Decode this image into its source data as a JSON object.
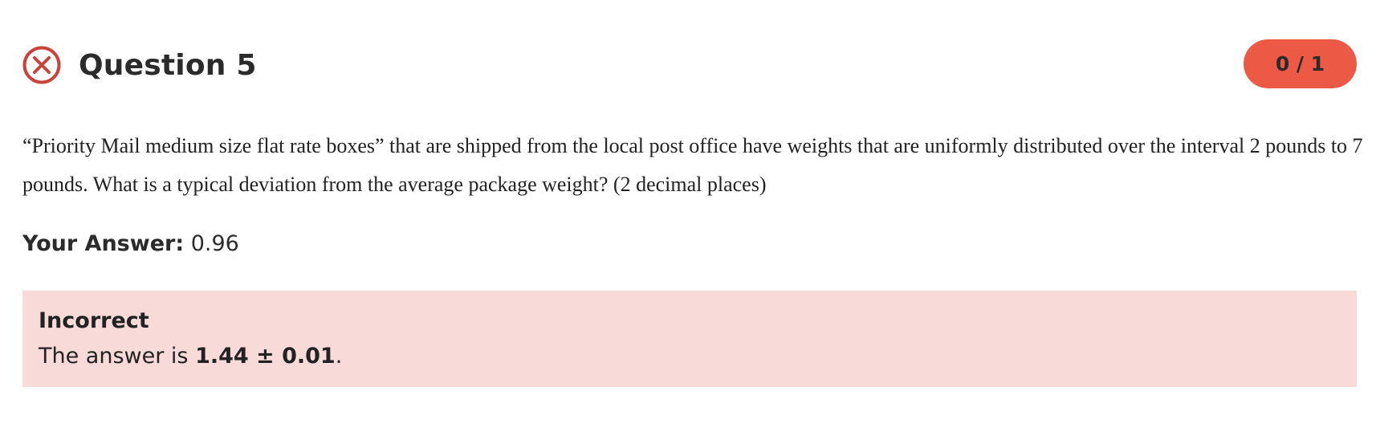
{
  "question": {
    "title": "Question 5",
    "status": "incorrect",
    "status_icon": "x-circle-icon",
    "status_color": "#c9433a",
    "score": "0 / 1",
    "score_badge_color": "#ec5a46",
    "text": "“Priority Mail medium size flat rate boxes” that are shipped from the local post office have weights that are uniformly distributed over the interval 2 pounds to 7 pounds. What is a typical deviation from the average package weight?  (2 decimal places)"
  },
  "your_answer": {
    "label": "Your Answer:",
    "value": "0.96"
  },
  "feedback": {
    "title": "Incorrect",
    "prefix": "The answer is ",
    "answer": "1.44 ± 0.01",
    "suffix": ".",
    "background_color": "#f8dad8"
  }
}
